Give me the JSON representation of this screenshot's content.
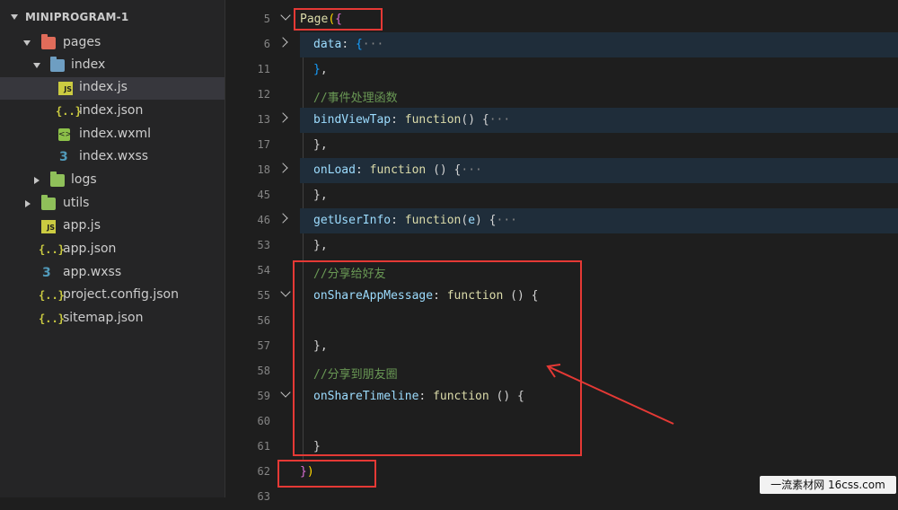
{
  "explorer": {
    "title": "MINIPROGRAM-1",
    "items": [
      {
        "label": "pages",
        "type": "folder",
        "kind": "pages"
      },
      {
        "label": "index",
        "type": "folder",
        "kind": "index"
      },
      {
        "label": "index.js",
        "type": "js"
      },
      {
        "label": "index.json",
        "type": "json"
      },
      {
        "label": "index.wxml",
        "type": "wxml"
      },
      {
        "label": "index.wxss",
        "type": "wxss"
      },
      {
        "label": "logs",
        "type": "folder",
        "kind": "logs"
      },
      {
        "label": "utils",
        "type": "folder",
        "kind": "utils"
      },
      {
        "label": "app.js",
        "type": "js"
      },
      {
        "label": "app.json",
        "type": "json"
      },
      {
        "label": "app.wxss",
        "type": "wxss"
      },
      {
        "label": "project.config.json",
        "type": "json"
      },
      {
        "label": "sitemap.json",
        "type": "json"
      }
    ]
  },
  "icons": {
    "js_glyph": "JS",
    "json_glyph": "{..}",
    "wxml_glyph": "<>",
    "wxss_glyph": "3"
  },
  "editor": {
    "lines": [
      {
        "num": "5",
        "p": [
          "Page",
          "(",
          "{"
        ]
      },
      {
        "num": "6",
        "p": [
          "data",
          ": ",
          "{",
          "···"
        ]
      },
      {
        "num": "11",
        "p": [
          "}",
          ","
        ]
      },
      {
        "num": "12",
        "p": [
          "//事件处理函数"
        ]
      },
      {
        "num": "13",
        "p": [
          "bindViewTap",
          ": ",
          "function",
          "()",
          " {",
          "···"
        ]
      },
      {
        "num": "17",
        "p": [
          "},"
        ]
      },
      {
        "num": "18",
        "p": [
          "onLoad",
          ": ",
          "function",
          " ()",
          " {",
          "···"
        ]
      },
      {
        "num": "45",
        "p": [
          "},"
        ]
      },
      {
        "num": "46",
        "p": [
          "getUserInfo",
          ": ",
          "function",
          "(",
          "e",
          ")",
          " {",
          "···"
        ]
      },
      {
        "num": "53",
        "p": [
          "},"
        ]
      },
      {
        "num": "54",
        "p": [
          "//分享给好友"
        ]
      },
      {
        "num": "55",
        "p": [
          "onShareAppMessage",
          ": ",
          "function",
          " ()",
          " {"
        ]
      },
      {
        "num": "56",
        "p": []
      },
      {
        "num": "57",
        "p": [
          "},"
        ]
      },
      {
        "num": "58",
        "p": [
          "//分享到朋友圈"
        ]
      },
      {
        "num": "59",
        "p": [
          "onShareTimeline",
          ": ",
          "function",
          " ()",
          " {"
        ]
      },
      {
        "num": "60",
        "p": []
      },
      {
        "num": "61",
        "p": [
          "}"
        ]
      },
      {
        "num": "62",
        "p": [
          "}",
          ")"
        ]
      },
      {
        "num": "63",
        "p": []
      }
    ]
  },
  "watermark": "一流素材网 16css.com",
  "colors": {
    "annotation": "#e53935",
    "background": "#1e1e1e",
    "sidebar": "#252526"
  }
}
